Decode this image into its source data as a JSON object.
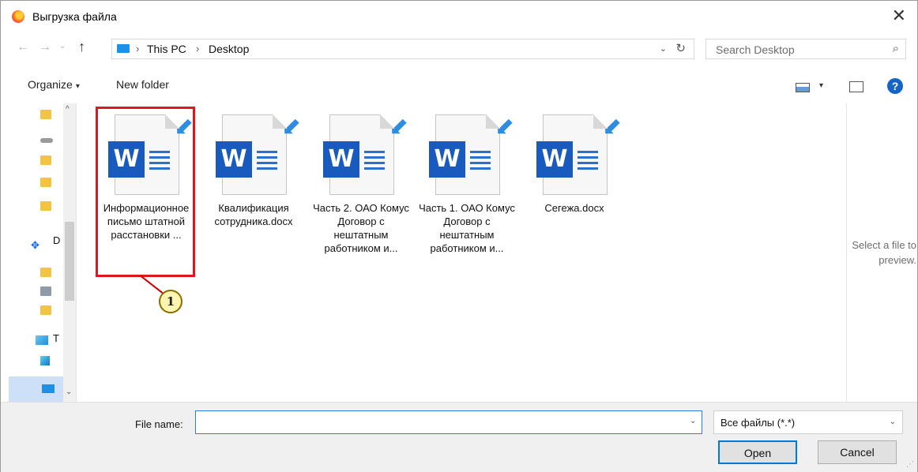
{
  "window": {
    "title": "Выгрузка файла",
    "close_glyph": "✕"
  },
  "nav": {
    "back_glyph": "←",
    "forward_glyph": "→",
    "recent_glyph": "⌄",
    "up_glyph": "↑",
    "breadcrumb": [
      "This PC",
      "Desktop"
    ],
    "separator": "›",
    "dropdown_glyph": "⌄",
    "refresh_glyph": "↻",
    "search_placeholder": "Search Desktop",
    "search_glyph": "⌕"
  },
  "toolbar": {
    "organize_label": "Organize",
    "organize_dd": "▾",
    "new_folder_label": "New folder",
    "view_dd": "▾",
    "help_glyph": "?"
  },
  "sidebar": {
    "scroll_up": "^",
    "scroll_down": "⌄",
    "labels": {
      "dropbox": "D",
      "this_pc": "T"
    },
    "dropbox_glyph": "✥"
  },
  "files": [
    {
      "name": "Информационное письмо штатной расстановки ..."
    },
    {
      "name": "Квалификация сотрудника.docx"
    },
    {
      "name": "Часть 2. ОАО Комус Договор с нештатным работником и..."
    },
    {
      "name": "Часть 1. ОАО Комус Договор с нештатным работником и..."
    },
    {
      "name": "Сегежа.docx"
    }
  ],
  "file_icon": {
    "letter": "W",
    "arrow_glyph": "⬋"
  },
  "annotation": {
    "label": "1",
    "color": "#e0161e"
  },
  "preview": {
    "text": "Select a file to preview."
  },
  "footer": {
    "file_name_label": "File name:",
    "file_name_value": "",
    "file_type": "Все файлы (*.*)",
    "dropdown_glyph": "⌄",
    "open_label": "Open",
    "cancel_label": "Cancel",
    "grip_glyph": "⋰"
  }
}
